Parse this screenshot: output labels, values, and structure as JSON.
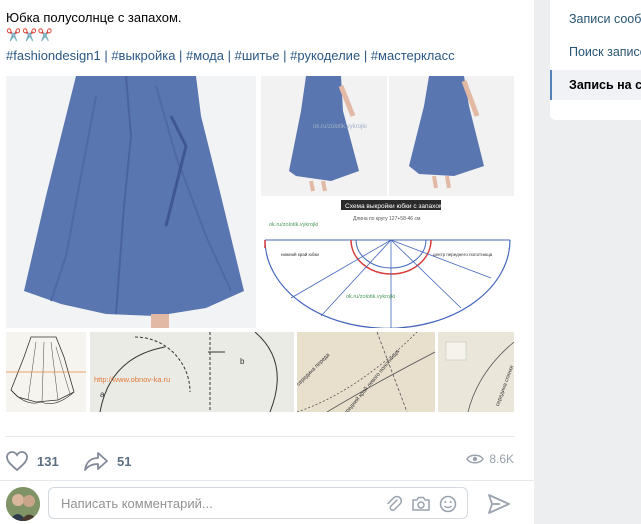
{
  "post": {
    "title": "Юбка полусолнце с запахом.",
    "emoji": "✂️✂️✂️",
    "tags": [
      "#fashiondesign1",
      "#выкройка",
      "#мода",
      "#шитье",
      "#рукоделие",
      "#мастеркласс"
    ],
    "tag_separator": "|",
    "photos": {
      "watermark_1": "ok.ru/zolotik.vykrojki",
      "pattern_title": "Схема выкройки юбки с запахом",
      "pattern_subtitle": "Длина по кругу 127+58-46 см",
      "pattern_watermark_top": "ok.ru/zolotik.vykrojki",
      "pattern_watermark_mid": "ok.ru/zolotik.vykrojki",
      "pattern_label_left": "нижний край юбки",
      "pattern_label_right": "центр переднего полотнища",
      "obnov_watermark": "http://www.obnov-ka.ru",
      "letter_a": "a",
      "letter_b": "b",
      "beige_text_1": "середина переда",
      "beige_text_2": "передний край левого полотнища",
      "beige_text_3": "середина спинки"
    }
  },
  "actions": {
    "likes": "131",
    "shares": "51",
    "views": "8.6K"
  },
  "comment": {
    "placeholder": "Написать комментарий..."
  },
  "sidebar": {
    "items": [
      {
        "label": "Записи сообщества"
      },
      {
        "label": "Поиск записей"
      },
      {
        "label": "Запись на стене"
      }
    ]
  },
  "colors": {
    "link": "#2a5885",
    "skirt_blue": "#5a76b0",
    "accent": "#5181b8",
    "pattern_red": "#d83a3a"
  }
}
